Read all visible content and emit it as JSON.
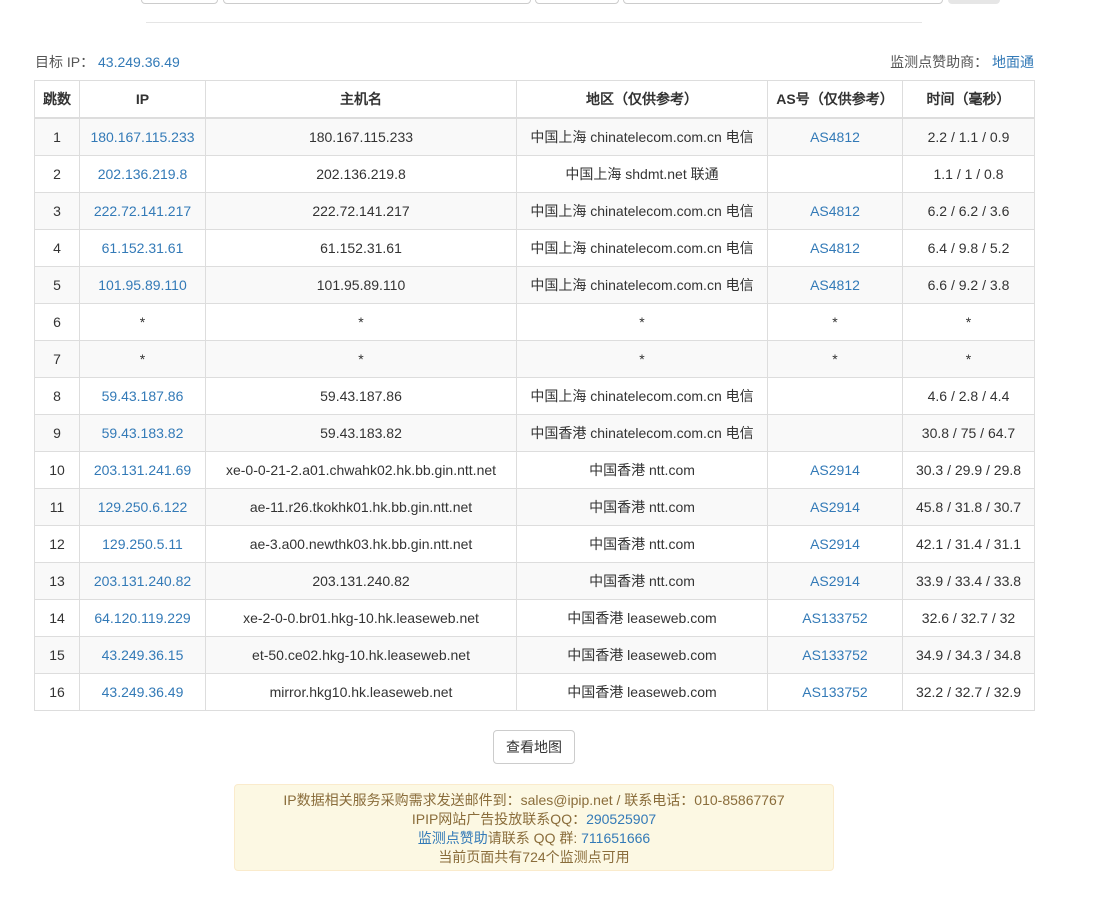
{
  "target": {
    "label": "目标 IP：",
    "ip": "43.249.36.49"
  },
  "sponsor": {
    "label": "监测点赞助商：",
    "name": "地面通"
  },
  "table": {
    "headers": [
      "跳数",
      "IP",
      "主机名",
      "地区（仅供参考）",
      "AS号（仅供参考）",
      "时间（毫秒）"
    ],
    "rows": [
      {
        "hop": "1",
        "ip": "180.167.115.233",
        "host": "180.167.115.233",
        "region": "中国上海 chinatelecom.com.cn 电信",
        "as": "AS4812",
        "time": "2.2 / 1.1 / 0.9"
      },
      {
        "hop": "2",
        "ip": "202.136.219.8",
        "host": "202.136.219.8",
        "region": "中国上海 shdmt.net 联通",
        "as": "",
        "time": "1.1 / 1 / 0.8"
      },
      {
        "hop": "3",
        "ip": "222.72.141.217",
        "host": "222.72.141.217",
        "region": "中国上海 chinatelecom.com.cn 电信",
        "as": "AS4812",
        "time": "6.2 / 6.2 / 3.6"
      },
      {
        "hop": "4",
        "ip": "61.152.31.61",
        "host": "61.152.31.61",
        "region": "中国上海 chinatelecom.com.cn 电信",
        "as": "AS4812",
        "time": "6.4 / 9.8 / 5.2"
      },
      {
        "hop": "5",
        "ip": "101.95.89.110",
        "host": "101.95.89.110",
        "region": "中国上海 chinatelecom.com.cn 电信",
        "as": "AS4812",
        "time": "6.6 / 9.2 / 3.8"
      },
      {
        "hop": "6",
        "ip": "*",
        "host": "*",
        "region": "*",
        "as": "*",
        "time": "*"
      },
      {
        "hop": "7",
        "ip": "*",
        "host": "*",
        "region": "*",
        "as": "*",
        "time": "*"
      },
      {
        "hop": "8",
        "ip": "59.43.187.86",
        "host": "59.43.187.86",
        "region": "中国上海 chinatelecom.com.cn 电信",
        "as": "",
        "time": "4.6 / 2.8 / 4.4"
      },
      {
        "hop": "9",
        "ip": "59.43.183.82",
        "host": "59.43.183.82",
        "region": "中国香港 chinatelecom.com.cn 电信",
        "as": "",
        "time": "30.8 / 75 / 64.7"
      },
      {
        "hop": "10",
        "ip": "203.131.241.69",
        "host": "xe-0-0-21-2.a01.chwahk02.hk.bb.gin.ntt.net",
        "region": "中国香港 ntt.com",
        "as": "AS2914",
        "time": "30.3 / 29.9 / 29.8"
      },
      {
        "hop": "11",
        "ip": "129.250.6.122",
        "host": "ae-11.r26.tkokhk01.hk.bb.gin.ntt.net",
        "region": "中国香港 ntt.com",
        "as": "AS2914",
        "time": "45.8 / 31.8 / 30.7"
      },
      {
        "hop": "12",
        "ip": "129.250.5.11",
        "host": "ae-3.a00.newthk03.hk.bb.gin.ntt.net",
        "region": "中国香港 ntt.com",
        "as": "AS2914",
        "time": "42.1 / 31.4 / 31.1"
      },
      {
        "hop": "13",
        "ip": "203.131.240.82",
        "host": "203.131.240.82",
        "region": "中国香港 ntt.com",
        "as": "AS2914",
        "time": "33.9 / 33.4 / 33.8"
      },
      {
        "hop": "14",
        "ip": "64.120.119.229",
        "host": "xe-2-0-0.br01.hkg-10.hk.leaseweb.net",
        "region": "中国香港 leaseweb.com",
        "as": "AS133752",
        "time": "32.6 / 32.7 / 32"
      },
      {
        "hop": "15",
        "ip": "43.249.36.15",
        "host": "et-50.ce02.hkg-10.hk.leaseweb.net",
        "region": "中国香港 leaseweb.com",
        "as": "AS133752",
        "time": "34.9 / 34.3 / 34.8"
      },
      {
        "hop": "16",
        "ip": "43.249.36.49",
        "host": "mirror.hkg10.hk.leaseweb.net",
        "region": "中国香港 leaseweb.com",
        "as": "AS133752",
        "time": "32.2 / 32.7 / 32.9"
      }
    ]
  },
  "map_button_label": "查看地图",
  "notice": {
    "line1": "IP数据相关服务采购需求发送邮件到：sales@ipip.net / 联系电话：010-85867767",
    "line2_prefix": "IPIP网站广告投放联系QQ：",
    "line2_qq": "290525907",
    "line3_link": "监测点赞助",
    "line3_middle": "请联系 QQ 群: ",
    "line3_group": "711651666",
    "line4": "当前页面共有724个监测点可用"
  }
}
